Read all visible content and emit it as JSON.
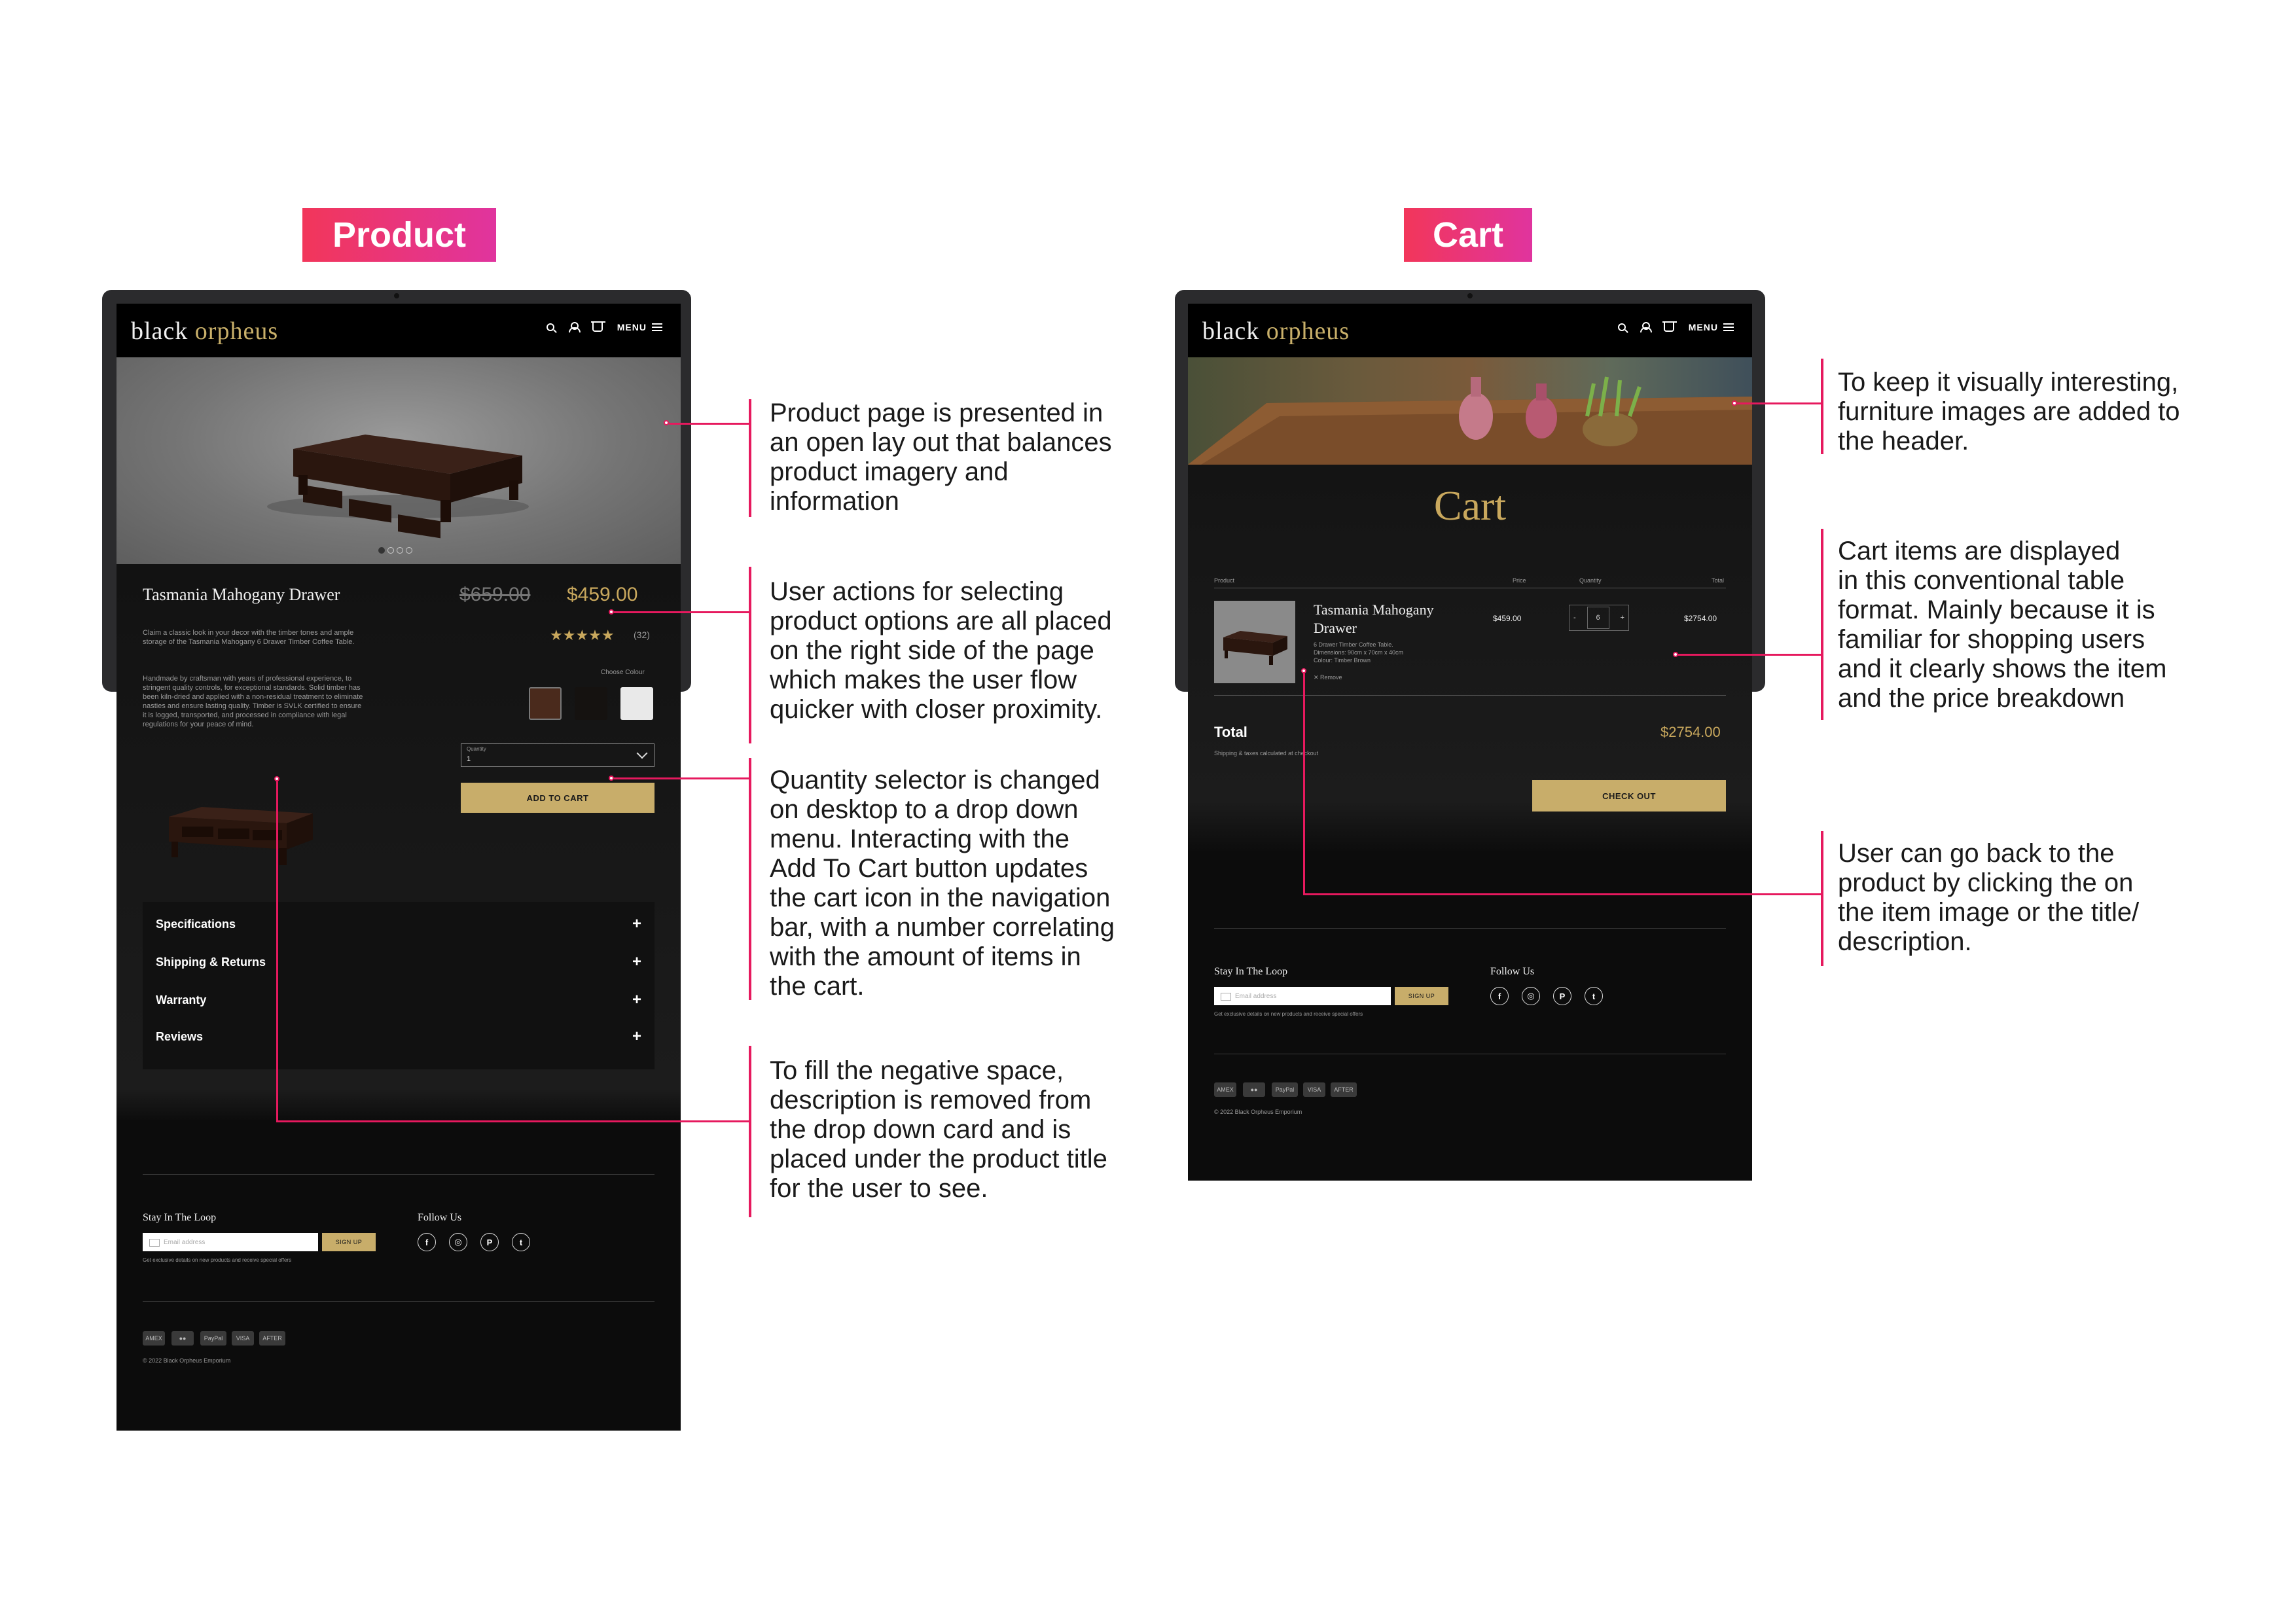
{
  "badges": {
    "product": "Product",
    "cart": "Cart"
  },
  "brand": {
    "logo_part1": "black",
    "logo_part2": "orpheus",
    "menu_label": "MENU"
  },
  "product_page": {
    "carousel_dots": 4,
    "title": "Tasmania Mahogany Drawer",
    "old_price": "$659.00",
    "price": "$459.00",
    "rating_stars": 5,
    "rating_count": "(32)",
    "short_desc": "Claim a classic look in your decor with the timber tones and ample storage of the Tasmania Mahogany 6 Drawer Timber Coffee Table.",
    "long_desc": "Handmade by craftsman with years of professional experience, to stringent quality controls, for exceptional standards. Solid timber has been kiln-dried and applied with a non-residual treatment to eliminate nasties and ensure lasting quality. Timber is SVLK certified to ensure it is logged, transported, and processed in compliance with legal regulations for your peace of mind.",
    "choose_colour_label": "Choose Colour",
    "colours": [
      "#4a2a1c",
      "#151210",
      "#e9e9e9"
    ],
    "quantity_label": "Quantity",
    "quantity_value": "1",
    "add_to_cart": "ADD TO CART",
    "accordion": [
      "Specifications",
      "Shipping & Returns",
      "Warranty",
      "Reviews"
    ]
  },
  "cart_page": {
    "heading": "Cart",
    "columns": {
      "product": "Product",
      "price": "Price",
      "quantity": "Quantity",
      "total": "Total"
    },
    "item": {
      "title": "Tasmania Mahogany Drawer",
      "desc1": "6 Drawer Timber Coffee Table.",
      "desc2": "Dimensions: 90cm x 70cm x 40cm",
      "desc3": "Colour: Timber Brown",
      "remove": "Remove",
      "price": "$459.00",
      "qty": "6",
      "minus": "-",
      "plus": "+",
      "total": "$2754.00"
    },
    "total_label": "Total",
    "total_value": "$2754.00",
    "shipping_note": "Shipping & taxes calculated at checkout",
    "checkout": "CHECK OUT"
  },
  "footer": {
    "stay_label": "Stay In The Loop",
    "email_placeholder": "Email address",
    "signup": "SIGN UP",
    "fine_print": "Get exclusive details on new products and receive special offers",
    "follow_label": "Follow Us",
    "socials": [
      "f",
      "◎",
      "P",
      "t"
    ],
    "payments": [
      "AMEX",
      "●●",
      "PayPal",
      "VISA",
      "AFTER"
    ],
    "copyright": "© 2022 Black Orpheus Emporium"
  },
  "annotations": {
    "product_layout": [
      "Product page is presented in",
      "an open lay out that balances",
      "product imagery and",
      "information"
    ],
    "user_actions": [
      "User actions for selecting",
      "product options are all placed",
      "on the right side of the page",
      "which makes the user flow",
      "quicker with closer proximity."
    ],
    "quantity_selector": [
      "Quantity selector is changed",
      "on desktop to a drop down",
      "menu. Interacting with the",
      "Add To Cart button updates",
      "the cart icon in the navigation",
      "bar, with a number correlating",
      "with the amount of items in",
      "the cart."
    ],
    "negative_space": [
      "To fill the negative space,",
      "description is removed from",
      "the drop down card and is",
      "placed under the product title",
      "for the user to see."
    ],
    "header_images": [
      "To keep it visually interesting,",
      "furniture images are added to",
      "the header."
    ],
    "cart_table": [
      "Cart items are displayed",
      "in this conventional table",
      "format. Mainly because it is",
      "familiar for shopping users",
      "and it clearly shows the item",
      "and the price breakdown"
    ],
    "go_back": [
      "User can go back to the",
      "product by clicking the on",
      "the item image or the title/",
      "description."
    ]
  }
}
